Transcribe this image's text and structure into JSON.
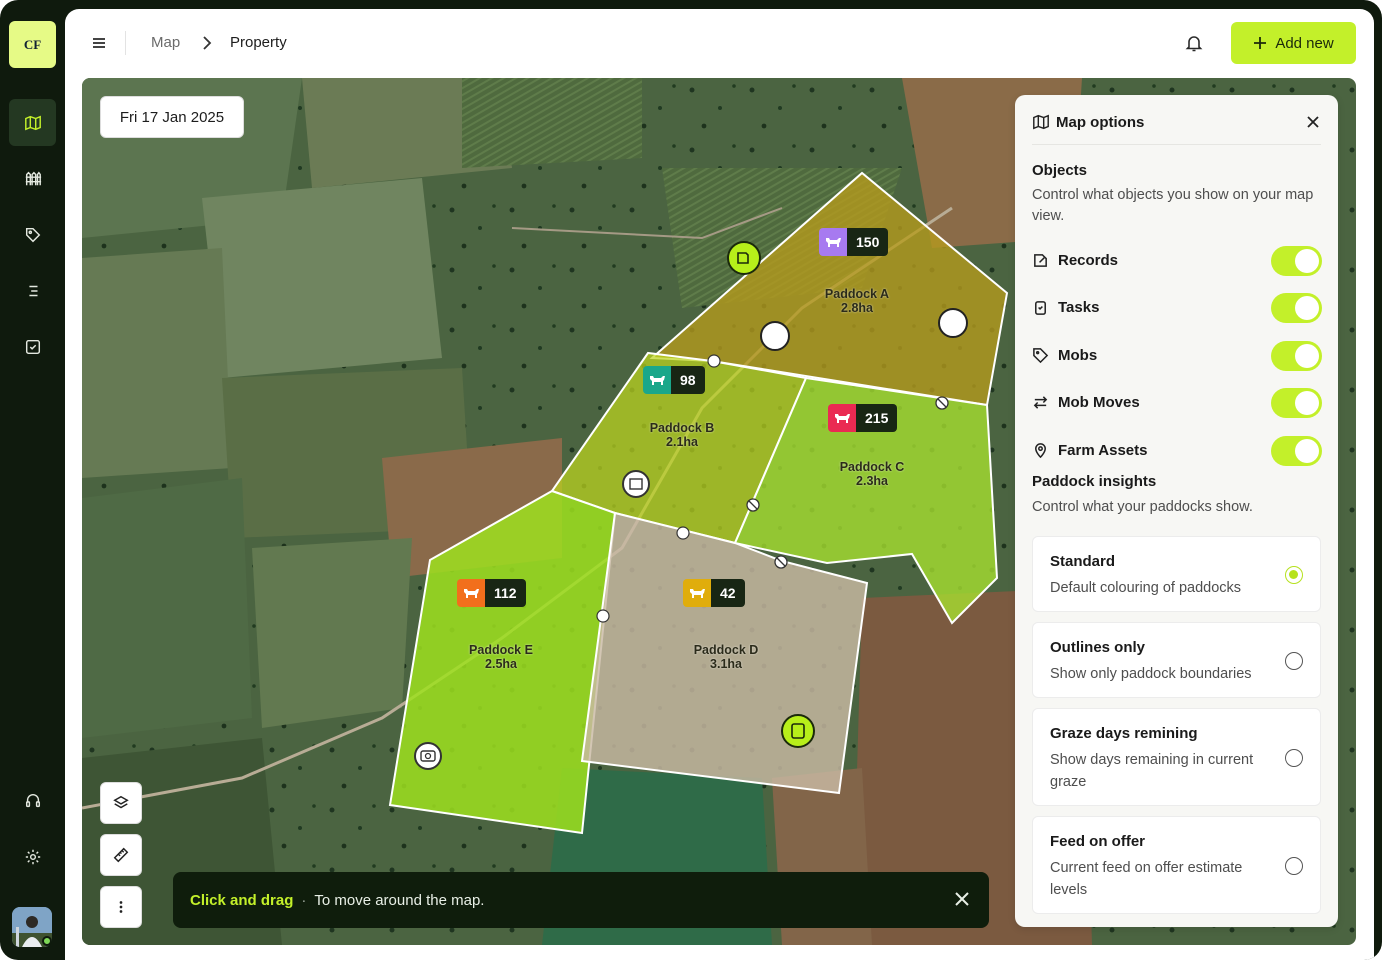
{
  "app": {
    "logo_text": "CF"
  },
  "sidebar": {
    "items": [
      {
        "icon": "map-icon",
        "active": true
      },
      {
        "icon": "fence-icon"
      },
      {
        "icon": "tag-icon"
      },
      {
        "icon": "list-icon"
      },
      {
        "icon": "task-check-icon"
      }
    ],
    "bottom": [
      {
        "icon": "support-icon"
      },
      {
        "icon": "gear-icon"
      }
    ]
  },
  "header": {
    "breadcrumb": [
      "Map",
      "Property"
    ],
    "add_label": "Add new"
  },
  "map": {
    "date": "Fri 17 Jan 2025",
    "toast": {
      "action": "Click and drag",
      "separator": "·",
      "text": "To move around the map."
    },
    "paddocks": [
      {
        "name": "Paddock A",
        "area": "2.8ha",
        "mob_count": "150",
        "mob_color": "#a77af0"
      },
      {
        "name": "Paddock B",
        "area": "2.1ha",
        "mob_count": "98",
        "mob_color": "#1aa78a"
      },
      {
        "name": "Paddock C",
        "area": "2.3ha",
        "mob_count": "215",
        "mob_color": "#ea2a52"
      },
      {
        "name": "Paddock D",
        "area": "3.1ha",
        "mob_count": "42",
        "mob_color": "#e0ad0c"
      },
      {
        "name": "Paddock E",
        "area": "2.5ha",
        "mob_count": "112",
        "mob_color": "#f26f1c"
      }
    ]
  },
  "options": {
    "title": "Map options",
    "objects_title": "Objects",
    "objects_desc": "Control what objects you show on your map view.",
    "toggles": [
      {
        "label": "Records",
        "icon": "records-icon",
        "on": true
      },
      {
        "label": "Tasks",
        "icon": "tasks-icon",
        "on": true
      },
      {
        "label": "Mobs",
        "icon": "tag-icon",
        "on": true
      },
      {
        "label": "Mob Moves",
        "icon": "arrows-icon",
        "on": true
      },
      {
        "label": "Farm Assets",
        "icon": "location-pin-icon",
        "on": true
      }
    ],
    "insights_title": "Paddock insights",
    "insights_desc": "Control what your paddocks show.",
    "insights": [
      {
        "title": "Standard",
        "desc": "Default colouring of paddocks",
        "selected": true
      },
      {
        "title": "Outlines only",
        "desc": "Show only paddock boundaries",
        "selected": false
      },
      {
        "title": "Graze days remining",
        "desc": "Show days remaining in current graze",
        "selected": false
      },
      {
        "title": "Feed on offer",
        "desc": "Current feed on offer estimate levels",
        "selected": false
      }
    ]
  },
  "colors": {
    "accent": "#c3f02a",
    "sidebar_bg": "#0f1a0d"
  }
}
